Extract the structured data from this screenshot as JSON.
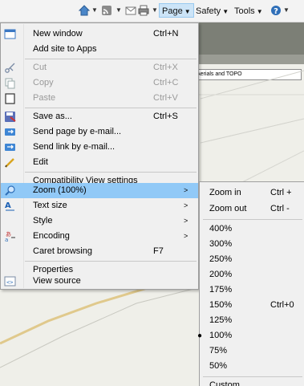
{
  "toolbar": {
    "page_label": "Page",
    "safety_label": "Safety",
    "tools_label": "Tools",
    "help_icon": "help-circle-icon"
  },
  "map": {
    "layer_field_value": "Aerials and TOPO"
  },
  "menu": {
    "items": [
      {
        "label": "New window",
        "shortcut": "Ctrl+N"
      },
      {
        "label": "Add site to Apps",
        "shortcut": ""
      },
      {
        "label": "Cut",
        "shortcut": "Ctrl+X"
      },
      {
        "label": "Copy",
        "shortcut": "Ctrl+C"
      },
      {
        "label": "Paste",
        "shortcut": "Ctrl+V"
      },
      {
        "label": "Save as...",
        "shortcut": "Ctrl+S"
      },
      {
        "label": "Send page by e-mail...",
        "shortcut": ""
      },
      {
        "label": "Send link by e-mail...",
        "shortcut": ""
      },
      {
        "label": "Edit",
        "shortcut": ""
      },
      {
        "label": "Compatibility View settings",
        "shortcut": ""
      },
      {
        "label": "Zoom (100%)",
        "shortcut": ""
      },
      {
        "label": "Text size",
        "shortcut": ""
      },
      {
        "label": "Style",
        "shortcut": ""
      },
      {
        "label": "Encoding",
        "shortcut": ""
      },
      {
        "label": "Caret browsing",
        "shortcut": "F7"
      },
      {
        "label": "Properties",
        "shortcut": ""
      },
      {
        "label": "View source",
        "shortcut": ""
      }
    ],
    "submenu_arrow": ">"
  },
  "zoom_submenu": {
    "items": [
      {
        "label": "Zoom in",
        "shortcut": "Ctrl +"
      },
      {
        "label": "Zoom out",
        "shortcut": "Ctrl -"
      },
      {
        "label": "400%",
        "shortcut": ""
      },
      {
        "label": "300%",
        "shortcut": ""
      },
      {
        "label": "250%",
        "shortcut": ""
      },
      {
        "label": "200%",
        "shortcut": ""
      },
      {
        "label": "175%",
        "shortcut": ""
      },
      {
        "label": "150%",
        "shortcut": "Ctrl+0"
      },
      {
        "label": "125%",
        "shortcut": ""
      },
      {
        "label": "100%",
        "shortcut": ""
      },
      {
        "label": "75%",
        "shortcut": ""
      },
      {
        "label": "50%",
        "shortcut": ""
      },
      {
        "label": "Custom...",
        "shortcut": ""
      }
    ],
    "selected_bullet": "●"
  }
}
